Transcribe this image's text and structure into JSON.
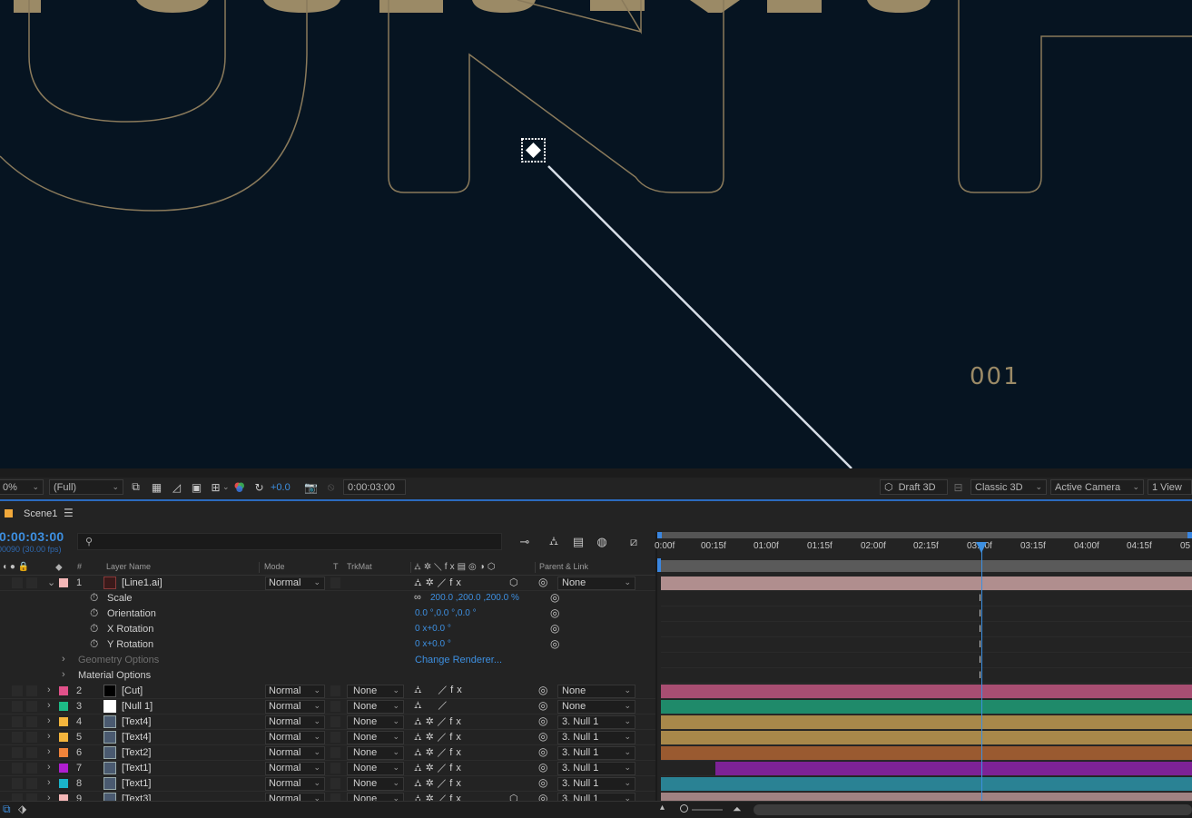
{
  "viewer": {
    "frame_number": "001"
  },
  "viewer_bar": {
    "zoom": "0%",
    "resolution": "(Full)",
    "exposure": "+0.0",
    "timecode": "0:00:03:00",
    "renderer": "Draft 3D",
    "renderer_mode": "Classic 3D",
    "camera": "Active Camera",
    "views": "1 View"
  },
  "comp": {
    "tab_name": "Scene1",
    "timecode": "0:00:03:00",
    "frames": "00090 (30.00 fps)"
  },
  "columns": {
    "layer_name": "Layer Name",
    "mode": "Mode",
    "t": "T",
    "trkmat": "TrkMat",
    "parent": "Parent & Link",
    "num": "#"
  },
  "ruler": {
    "labels": [
      "0:00f",
      "00:15f",
      "01:00f",
      "01:15f",
      "02:00f",
      "02:15f",
      "03:00f",
      "03:15f",
      "04:00f",
      "04:15f",
      "05"
    ]
  },
  "layer1": {
    "num": "1",
    "name": "[Line1.ai]",
    "mode": "Normal",
    "parent": "None",
    "label_color": "#f4b7b7",
    "bar_color": "#b08e8e",
    "properties": [
      {
        "name": "Scale",
        "value": "200.0 ,200.0 ,200.0 %"
      },
      {
        "name": "Orientation",
        "value": "0.0 °,0.0 °,0.0 °"
      },
      {
        "name": "X Rotation",
        "value": "0 x+0.0 °"
      },
      {
        "name": "Y Rotation",
        "value": "0 x+0.0 °"
      }
    ],
    "geometry_options": "Geometry Options",
    "change_renderer": "Change Renderer...",
    "material_options": "Material Options"
  },
  "layers": [
    {
      "num": "2",
      "name": "[Cut]",
      "mode": "Normal",
      "trkmat": "None",
      "parent": "None",
      "label_color": "#e1518a",
      "bar_color": "#a84e72",
      "src": "black"
    },
    {
      "num": "3",
      "name": "[Null 1]",
      "mode": "Normal",
      "trkmat": "None",
      "parent": "None",
      "label_color": "#1dba86",
      "bar_color": "#1f8a6a",
      "src": "white"
    },
    {
      "num": "4",
      "name": "[Text4]",
      "mode": "Normal",
      "trkmat": "None",
      "parent": "3. Null 1",
      "label_color": "#f4b53d",
      "bar_color": "#a8884a",
      "src": "comp"
    },
    {
      "num": "5",
      "name": "[Text4]",
      "mode": "Normal",
      "trkmat": "None",
      "parent": "3. Null 1",
      "label_color": "#f4b53d",
      "bar_color": "#a8884a",
      "src": "comp"
    },
    {
      "num": "6",
      "name": "[Text2]",
      "mode": "Normal",
      "trkmat": "None",
      "parent": "3. Null 1",
      "label_color": "#f0833a",
      "bar_color": "#9a5a30",
      "src": "comp"
    },
    {
      "num": "7",
      "name": "[Text1]",
      "mode": "Normal",
      "trkmat": "None",
      "parent": "3. Null 1",
      "label_color": "#b01ed0",
      "bar_color": "#7d2296",
      "src": "comp"
    },
    {
      "num": "8",
      "name": "[Text1]",
      "mode": "Normal",
      "trkmat": "None",
      "parent": "3. Null 1",
      "label_color": "#1ab3c9",
      "bar_color": "#2a8294",
      "src": "comp"
    },
    {
      "num": "9",
      "name": "[Text3]",
      "mode": "Normal",
      "trkmat": "None",
      "parent": "3. Null 1",
      "label_color": "#f4b7b7",
      "bar_color": "#a08282",
      "src": "comp"
    }
  ]
}
